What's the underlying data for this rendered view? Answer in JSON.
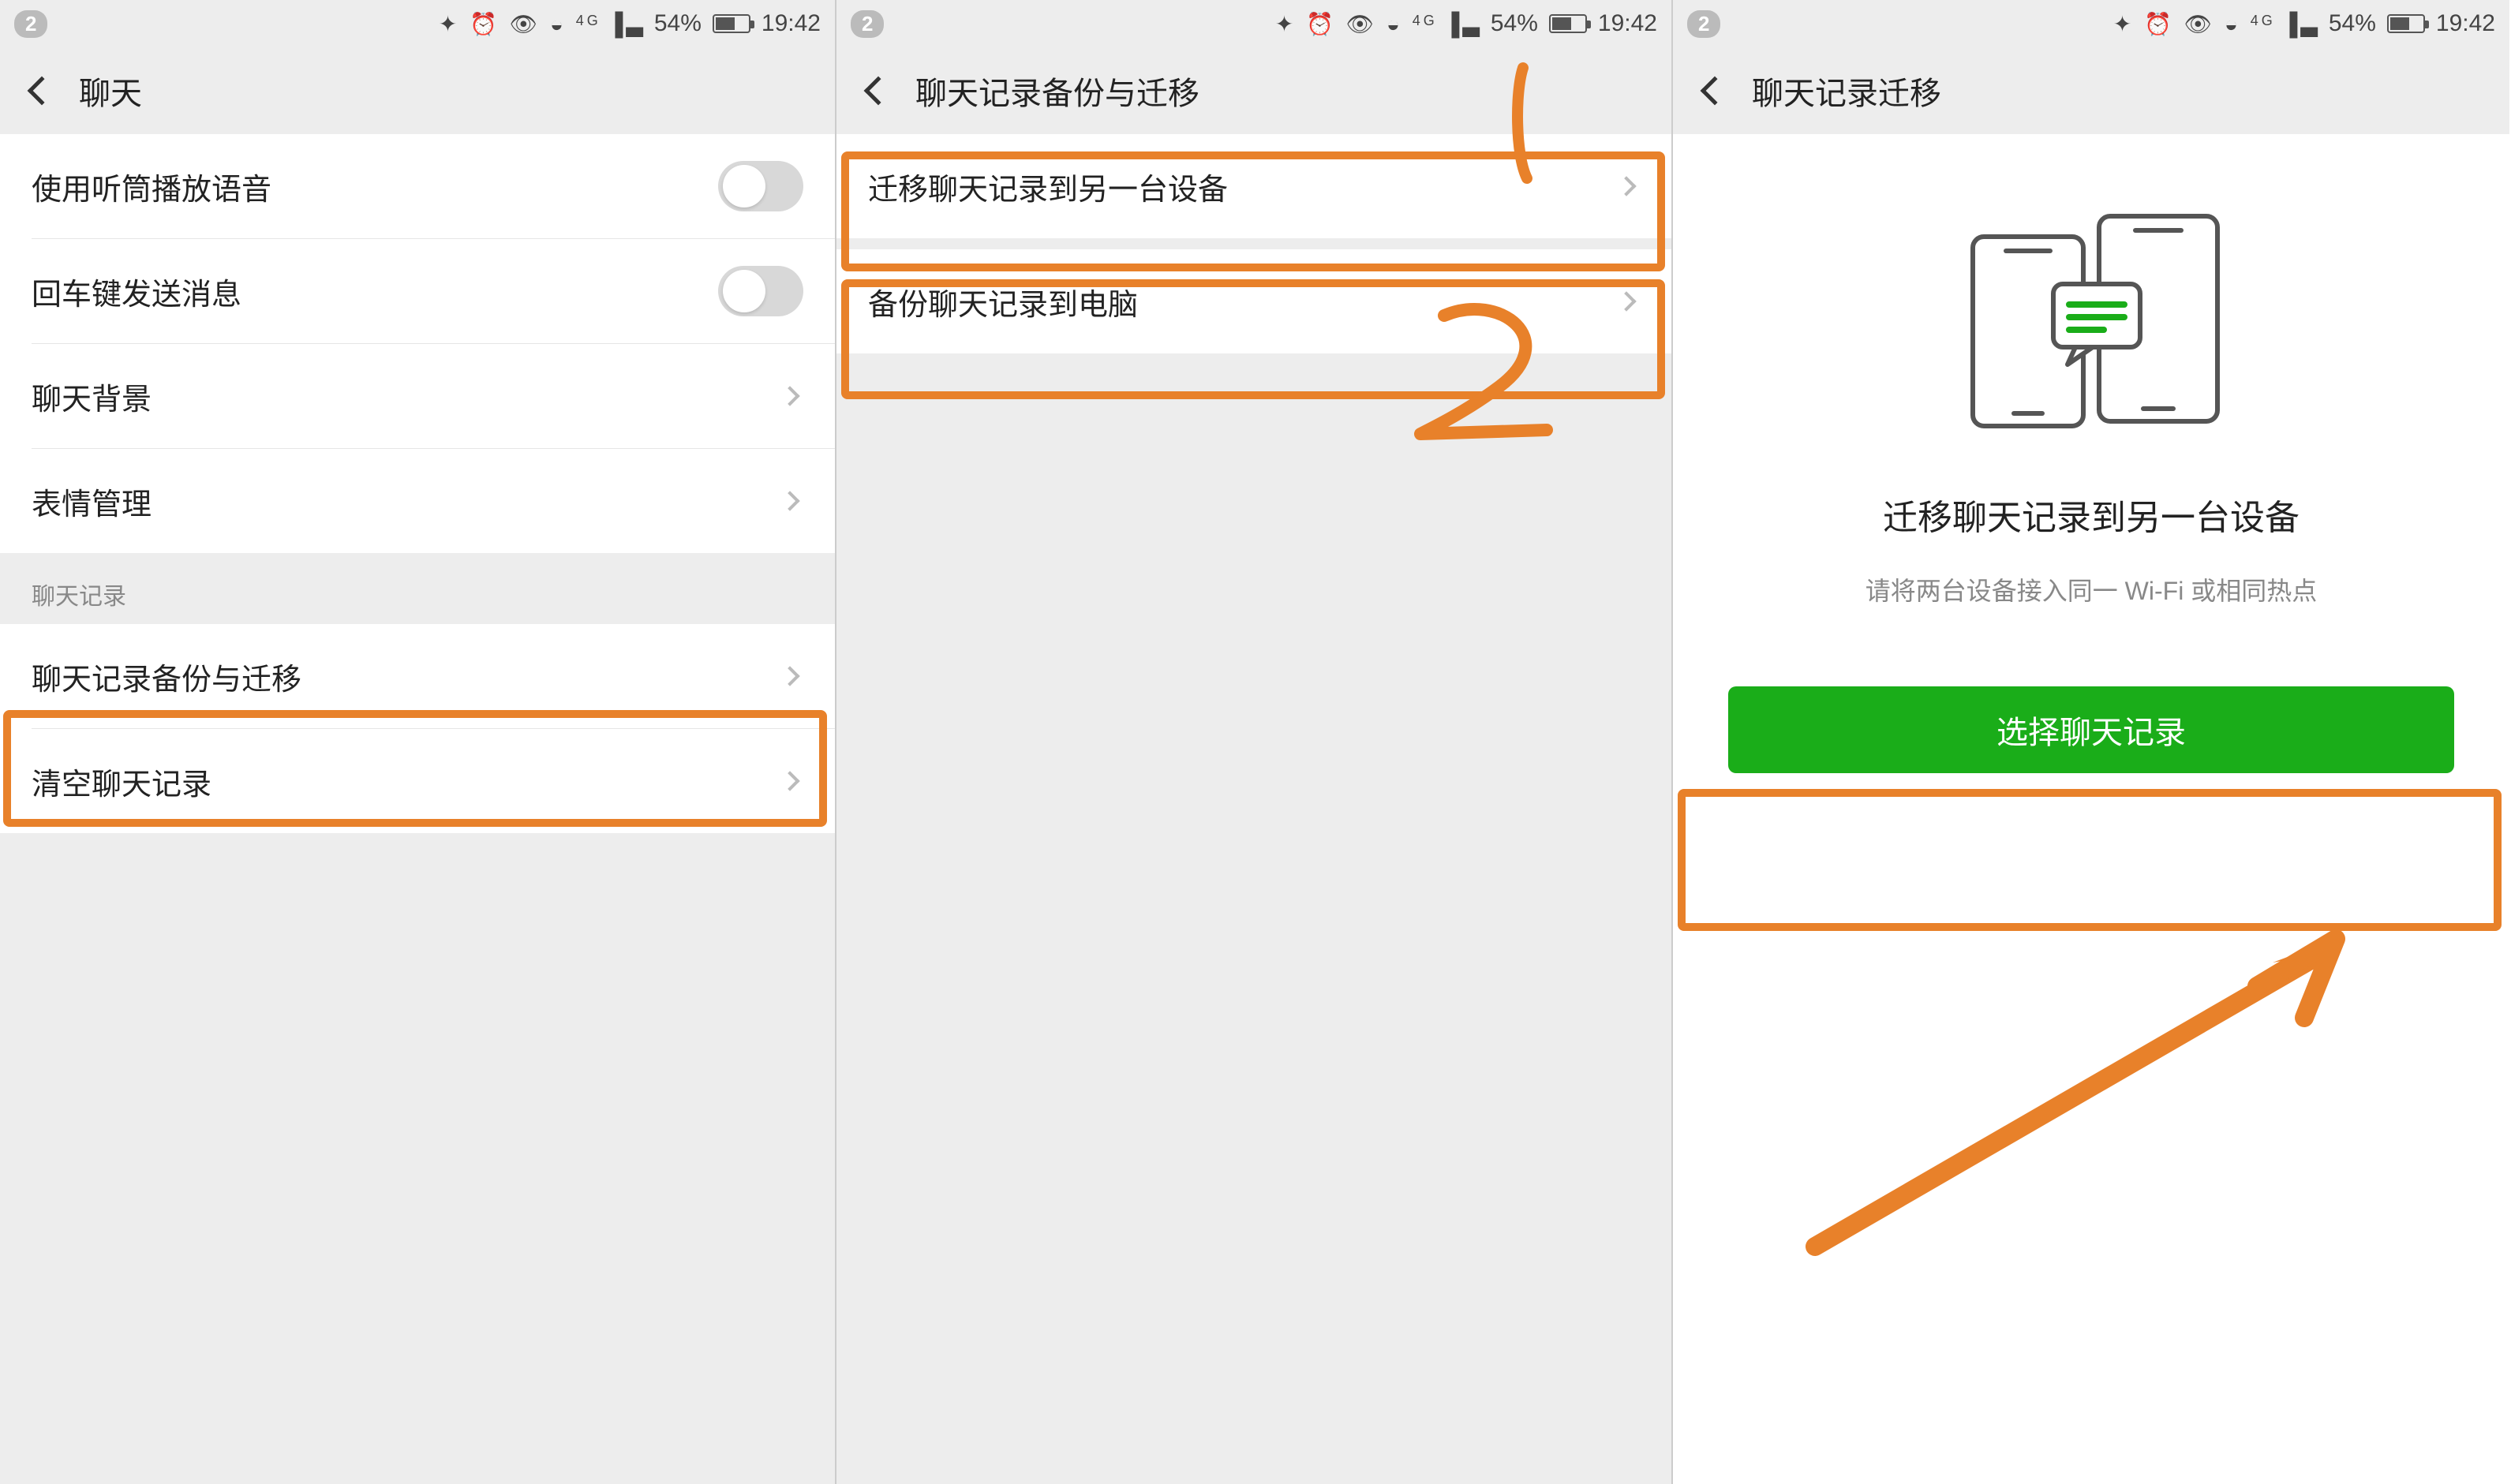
{
  "status": {
    "notif_count": "2",
    "bt_icon": "bluetooth",
    "alarm_icon": "alarm",
    "eye_icon": "eye-care",
    "wifi_icon": "wifi",
    "network_label": "4G",
    "signal_icon": "signal",
    "battery_pct": "54%",
    "time": "19:42"
  },
  "panel1": {
    "title": "聊天",
    "rows": {
      "earpiece": "使用听筒播放语音",
      "enter_send": "回车键发送消息",
      "bg": "聊天背景",
      "sticker": "表情管理",
      "section": "聊天记录",
      "backup": "聊天记录备份与迁移",
      "clear": "清空聊天记录"
    }
  },
  "panel2": {
    "title": "聊天记录备份与迁移",
    "rows": {
      "migrate": "迁移聊天记录到另一台设备",
      "backup_pc": "备份聊天记录到电脑"
    },
    "annotations": {
      "num1": "1",
      "num2": "2"
    }
  },
  "panel3": {
    "title": "聊天记录迁移",
    "hero_title": "迁移聊天记录到另一台设备",
    "hero_sub": "请将两台设备接入同一 Wi-Fi 或相同热点",
    "button": "选择聊天记录"
  },
  "colors": {
    "highlight": "#e8812a",
    "green": "#1AAD19"
  }
}
